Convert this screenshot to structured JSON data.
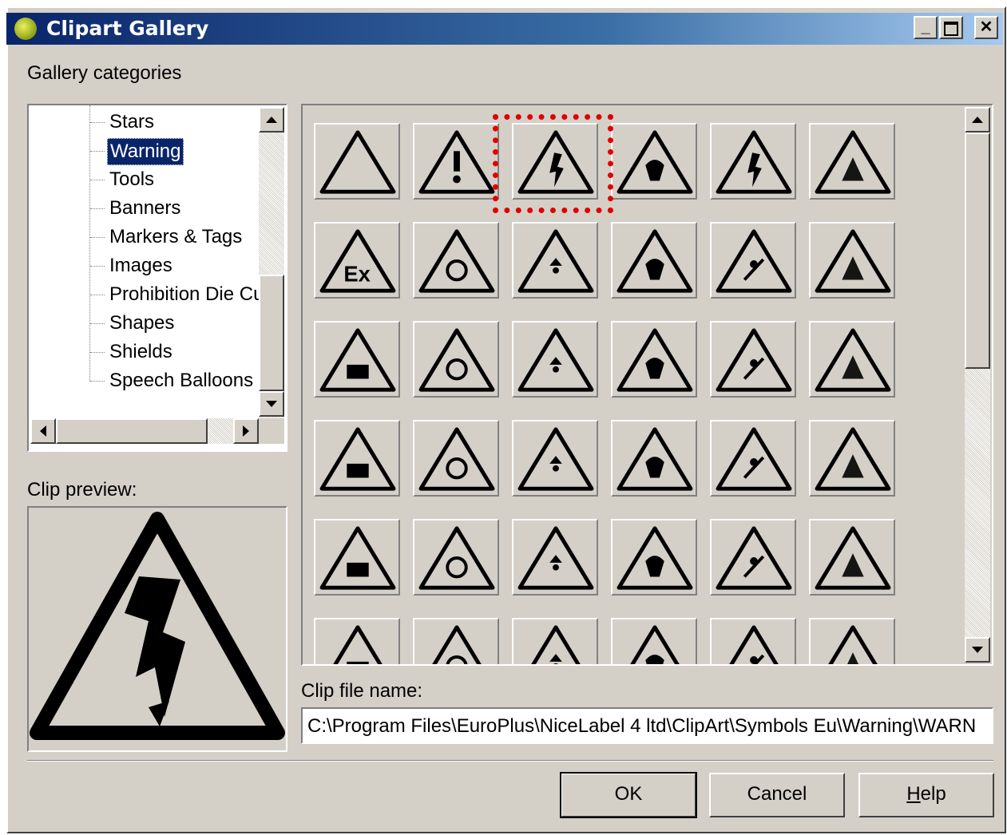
{
  "window": {
    "title": "Clipart Gallery",
    "controls": [
      "minimize",
      "maximize",
      "close"
    ]
  },
  "categories": {
    "label": "Gallery categories",
    "items": [
      "Stars",
      "Warning",
      "Tools",
      "Banners",
      "Markers & Tags",
      "Images",
      "Prohibition Die Cu",
      "Shapes",
      "Shields",
      "Speech Balloons"
    ],
    "selected": "Warning"
  },
  "preview": {
    "label": "Clip preview:",
    "icon": "high-voltage-warning-icon"
  },
  "gallery": {
    "selected_index": 2,
    "clips": [
      "blank-warning-icon",
      "exclamation-warning-icon",
      "high-voltage-warning-icon",
      "electric-shock-warning-icon",
      "lightning-warning-icon",
      "explosive-warning-icon",
      "ex-explosive-atmosphere-icon",
      "flammable-warning-icon",
      "oxidizing-warning-icon",
      "corrosive-warning-icon",
      "battery-acid-warning-icon",
      "toxic-skull-warning-icon",
      "harmful-irritant-warning-icon",
      "biohazard-warning-icon",
      "radiation-warning-icon",
      "cold-temperature-warning-icon",
      "laser-warning-icon",
      "gas-cylinder-warning-icon",
      "truck-warning-icon",
      "forklift-warning-icon",
      "excavator-warning-icon",
      "digger-warning-icon",
      "running-person-warning-icon",
      "fall-stairs-warning-icon",
      "slip-warning-icon",
      "slippery-steps-warning-icon",
      "falling-person-warning-icon",
      "wet-floor-warning-icon",
      "floor-hole-warning-icon",
      "sand-slip-warning-icon",
      "overhead-load-warning-icon",
      "hot-surface-warning-icon",
      "entanglement-warning-icon",
      "crane-hook-warning-icon",
      "pedestrian-warning-icon",
      "obstacle-warning-icon"
    ]
  },
  "file": {
    "label": "Clip file name:",
    "value": "C:\\Program Files\\EuroPlus\\NiceLabel 4 ltd\\ClipArt\\Symbols Eu\\Warning\\WARN"
  },
  "buttons": {
    "ok": "OK",
    "cancel": "Cancel",
    "help": "Help"
  }
}
